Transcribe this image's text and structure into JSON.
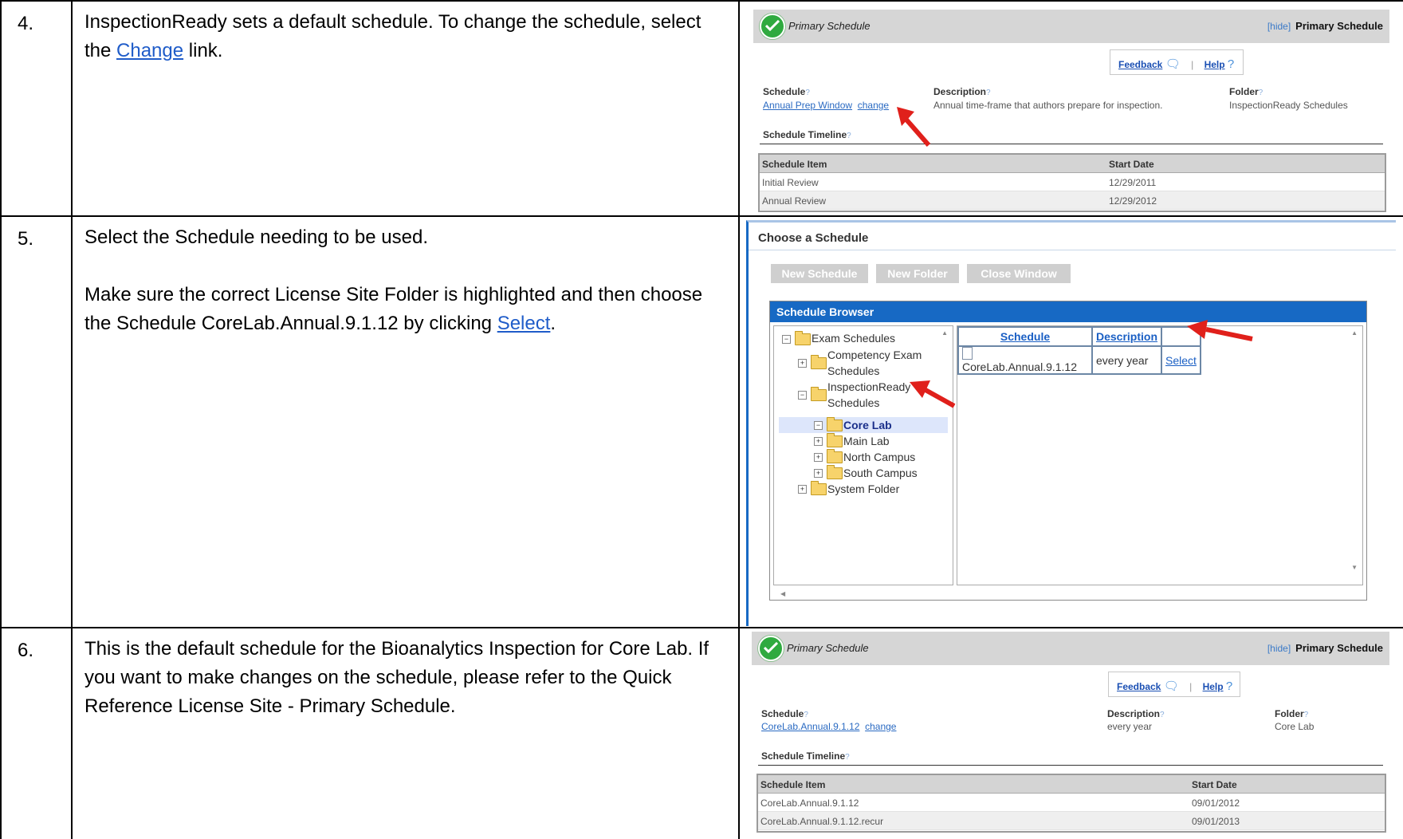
{
  "rows": [
    {
      "num": "4.",
      "text_before": "InspectionReady sets a default schedule.  To change the schedule, select the ",
      "link": "Change",
      "text_after": " link."
    },
    {
      "num": "5.",
      "line1": "Select the Schedule needing to be used.",
      "line2_before": "Make sure the correct License Site Folder is highlighted and then choose the Schedule CoreLab.Annual.9.1.12 by clicking ",
      "link": "Select",
      "line2_after": "."
    },
    {
      "num": "6.",
      "text": "This is the default schedule for the Bioanalytics Inspection for Core Lab. If you want to make changes on the schedule, please refer to the Quick Reference License Site - Primary Schedule."
    }
  ],
  "shot1": {
    "header_title": "Primary Schedule",
    "hide": "[hide]",
    "header_right": "Primary Schedule",
    "feedback": "Feedback",
    "help": "Help",
    "schedule_label": "Schedule",
    "schedule_value": "Annual Prep Window",
    "change": "change",
    "description_label": "Description",
    "description_value": "Annual time-frame that authors prepare for inspection.",
    "folder_label": "Folder",
    "folder_value": "InspectionReady Schedules",
    "timeline_label": "Schedule Timeline",
    "col_item": "Schedule Item",
    "col_date": "Start Date",
    "items": [
      {
        "item": "Initial Review",
        "date": "12/29/2011"
      },
      {
        "item": "Annual Review",
        "date": "12/29/2012"
      }
    ]
  },
  "shot2": {
    "title": "Choose a Schedule",
    "buttons": [
      "New Schedule",
      "New Folder",
      "Close Window"
    ],
    "browser_title": "Schedule Browser",
    "tree": [
      {
        "label": "Exam Schedules"
      },
      {
        "label": "Competency Exam",
        "label2": "Schedules"
      },
      {
        "label": "InspectionReady",
        "label2": "Schedules"
      },
      {
        "label": "Core Lab"
      },
      {
        "label": "Main Lab"
      },
      {
        "label": "North Campus"
      },
      {
        "label": "South Campus"
      },
      {
        "label": "System Folder"
      }
    ],
    "col_schedule": "Schedule",
    "col_description": "Description",
    "result_schedule": "CoreLab.Annual.9.1.12",
    "result_description": "every year",
    "result_select": "Select"
  },
  "shot3": {
    "header_title": "Primary Schedule",
    "hide": "[hide]",
    "header_right": "Primary Schedule",
    "feedback": "Feedback",
    "help": "Help",
    "schedule_label": "Schedule",
    "schedule_value": "CoreLab.Annual.9.1.12",
    "change": "change",
    "description_label": "Description",
    "description_value": "every year",
    "folder_label": "Folder",
    "folder_value": "Core Lab",
    "timeline_label": "Schedule Timeline",
    "col_item": "Schedule Item",
    "col_date": "Start Date",
    "items": [
      {
        "item": "CoreLab.Annual.9.1.12",
        "date": "09/01/2012"
      },
      {
        "item": "CoreLab.Annual.9.1.12.recur",
        "date": "09/01/2013"
      }
    ]
  },
  "colors": {
    "grid_border": "#000000",
    "browser_blue": "#1769c4",
    "check_green": "#2faa3f",
    "arrow_red": "#e0201b",
    "link_blue": "#1f5cc9"
  }
}
